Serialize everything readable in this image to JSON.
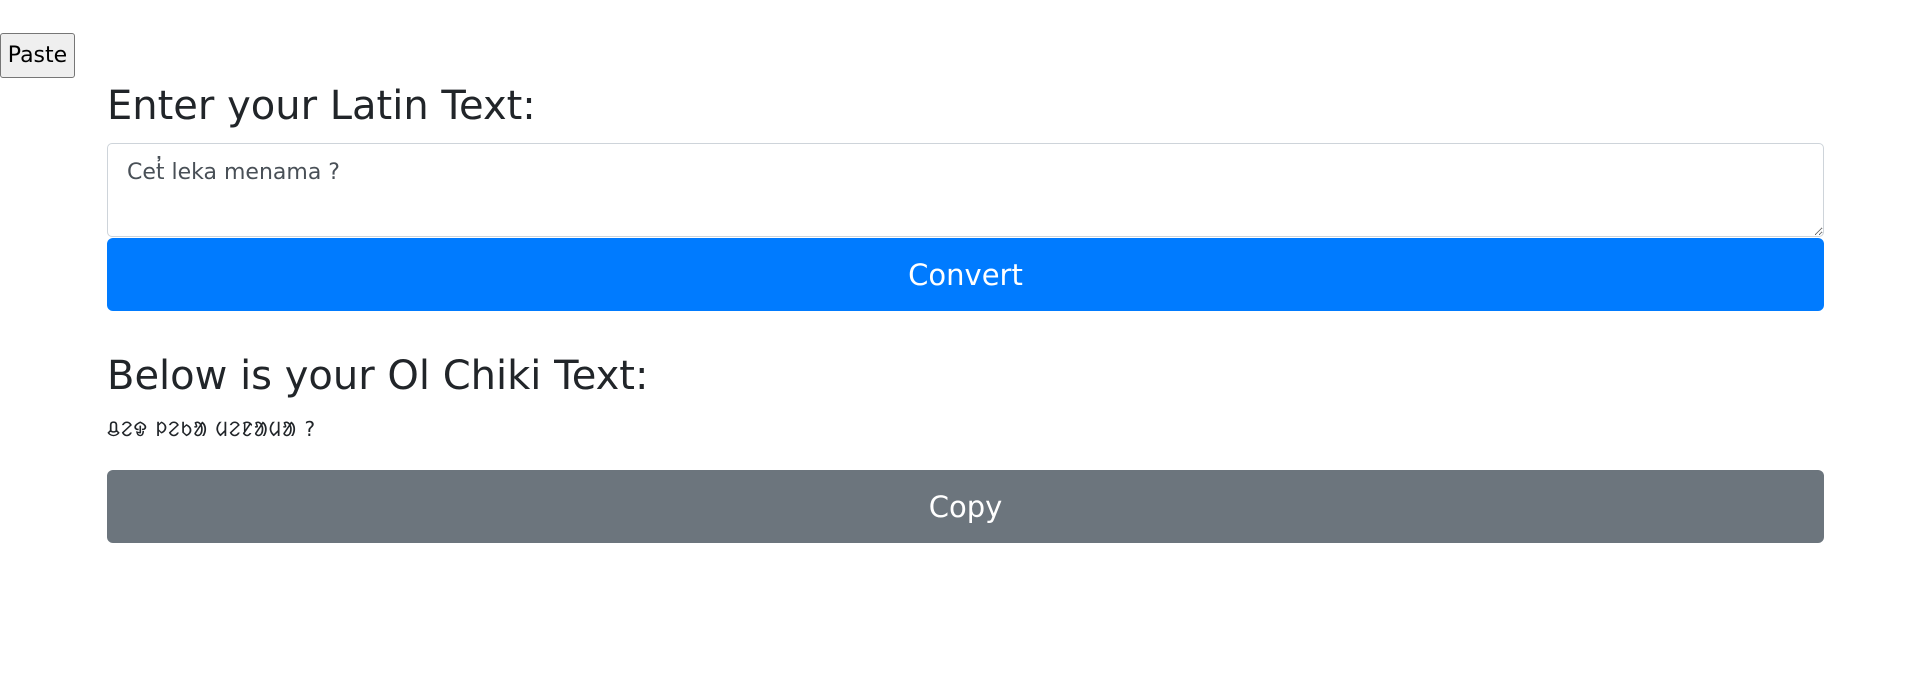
{
  "toolbar": {
    "paste_label": "Paste"
  },
  "input_section": {
    "heading": "Enter your Latin Text:",
    "textarea_value": "Cet̓ leka menama ?",
    "convert_label": "Convert"
  },
  "output_section": {
    "heading": "Below is your Ol Chiki Text:",
    "output_text": "ᱪᱮᱫ ᱞᱮᱠᱟ ᱢᱮᱱᱟᱢᱟ ?",
    "copy_label": "Copy"
  },
  "colors": {
    "convert_button": "#007bff",
    "copy_button": "#6c757d"
  }
}
